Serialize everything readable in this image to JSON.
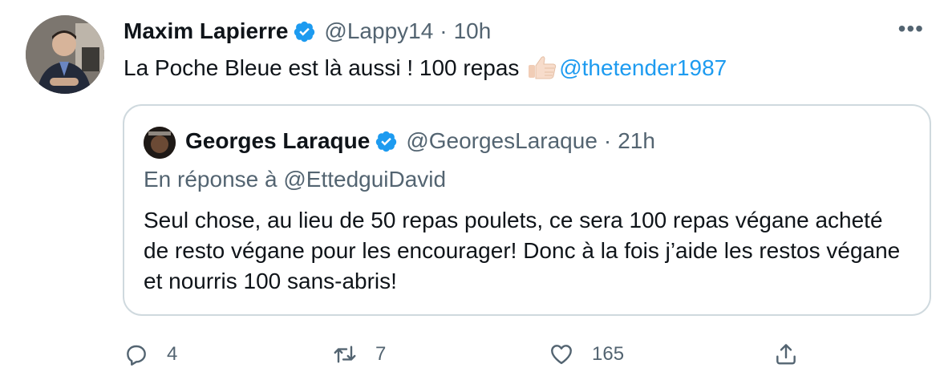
{
  "tweet": {
    "author_name": "Maxim Lapierre",
    "author_handle": "@Lappy14",
    "separator": "·",
    "time": "10h",
    "text": "La Poche Bleue est là aussi ! 100 repas",
    "emoji": "thumbs-up-icon",
    "mention": "@thetender1987",
    "more_label": "•••"
  },
  "quote": {
    "author_name": "Georges Laraque",
    "author_handle": "@GeorgesLaraque",
    "separator": "·",
    "time": "21h",
    "reply_to": "En réponse à @EttedguiDavid",
    "text": "Seul chose, au lieu de 50 repas poulets, ce sera 100 repas végane acheté de resto végane pour les encourager! Donc à la fois j’aide les restos végane et nourris 100 sans-abris!"
  },
  "actions": {
    "reply_count": "4",
    "retweet_count": "7",
    "like_count": "165",
    "share_icon": "share-icon"
  },
  "colors": {
    "accent": "#1d9bf0",
    "secondary_text": "#536471",
    "border": "#cfd9de"
  }
}
